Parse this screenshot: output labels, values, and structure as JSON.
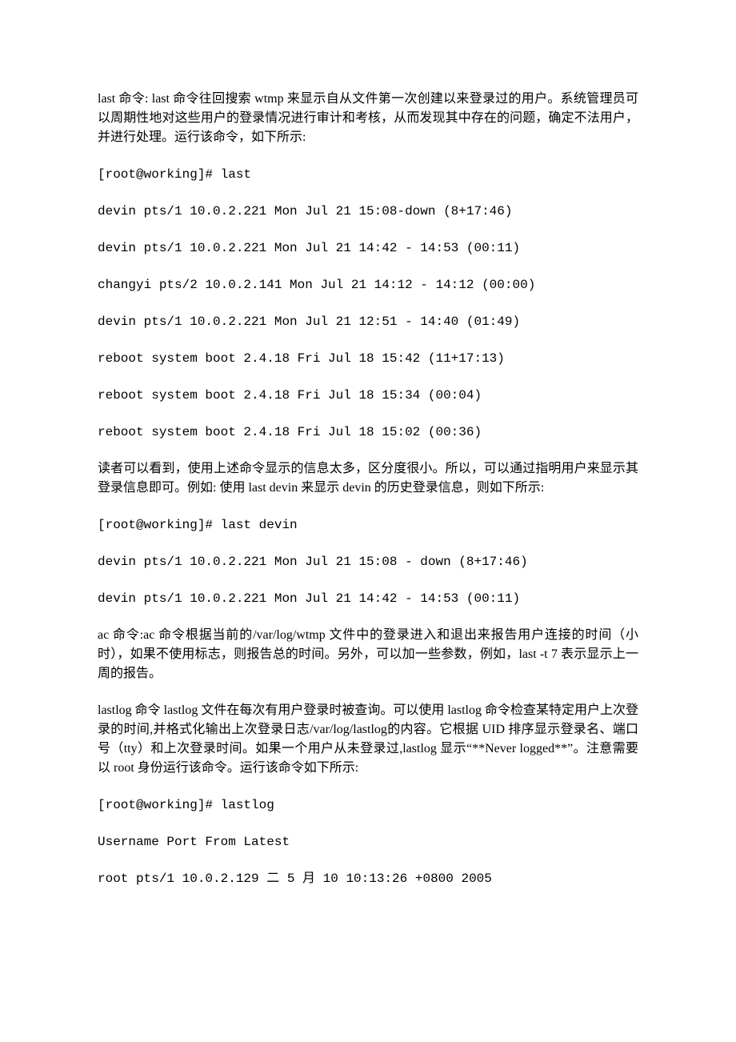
{
  "paragraphs": {
    "p1": "last 命令: last 命令往回搜索 wtmp 来显示自从文件第一次创建以来登录过的用户。系统管理员可以周期性地对这些用户的登录情况进行审计和考核，从而发现其中存在的问题，确定不法用户，并进行处理。运行该命令，如下所示:",
    "p2": "读者可以看到，使用上述命令显示的信息太多，区分度很小。所以，可以通过指明用户来显示其登录信息即可。例如: 使用 last devin 来显示 devin 的历史登录信息，则如下所示:",
    "p3": "ac 命令:ac 命令根据当前的/var/log/wtmp 文件中的登录进入和退出来报告用户连接的时间（小时），如果不使用标志，则报告总的时间。另外，可以加一些参数，例如，last -t 7 表示显示上一周的报告。",
    "p4": "lastlog 命令 lastlog 文件在每次有用户登录时被查询。可以使用 lastlog 命令检查某特定用户上次登录的时间,并格式化输出上次登录日志/var/log/lastlog的内容。它根据 UID 排序显示登录名、端口号（tty）和上次登录时间。如果一个用户从未登录过,lastlog 显示“**Never logged**”。注意需要以 root 身份运行该命令。运行该命令如下所示:"
  },
  "terminal": {
    "cmd1": "[root@working]# last",
    "out1": [
      "devin pts/1 10.0.2.221 Mon Jul 21 15:08-down (8+17:46)",
      "devin pts/1 10.0.2.221 Mon Jul 21 14:42 - 14:53 (00:11)",
      "changyi pts/2 10.0.2.141 Mon Jul 21 14:12 - 14:12 (00:00)",
      "devin pts/1 10.0.2.221 Mon Jul 21 12:51 - 14:40 (01:49)",
      "reboot system boot 2.4.18 Fri Jul 18 15:42 (11+17:13)",
      "reboot system boot 2.4.18 Fri Jul 18 15:34 (00:04)",
      "reboot system boot 2.4.18 Fri Jul 18 15:02 (00:36)"
    ],
    "cmd2": "[root@working]# last devin",
    "out2": [
      "devin pts/1 10.0.2.221 Mon Jul 21 15:08 - down (8+17:46)",
      "devin pts/1 10.0.2.221 Mon Jul 21 14:42 - 14:53 (00:11)"
    ],
    "cmd3": "[root@working]# lastlog",
    "out3": [
      "Username Port From Latest",
      "root pts/1 10.0.2.129 二 5 月 10 10:13:26 +0800 2005"
    ]
  }
}
